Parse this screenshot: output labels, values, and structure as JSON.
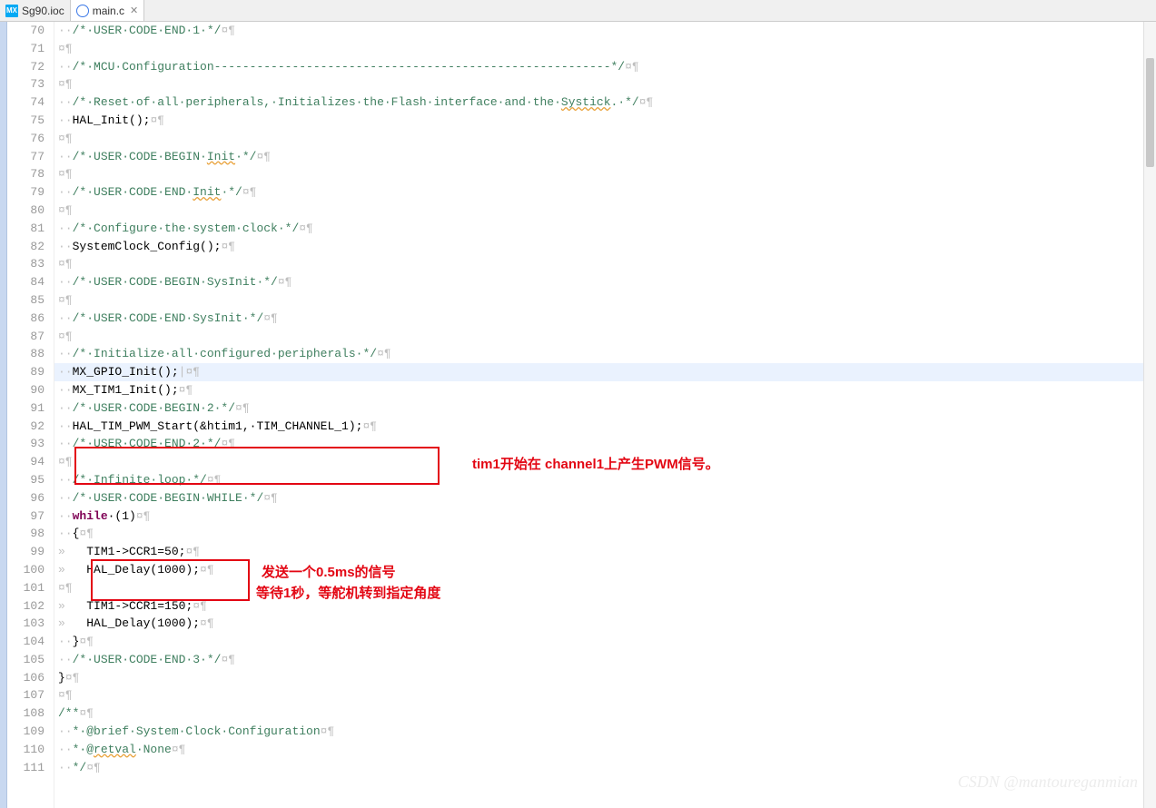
{
  "tabs": [
    {
      "label": "Sg90.ioc",
      "icon": "mx",
      "active": false
    },
    {
      "label": "main.c",
      "icon": "c",
      "active": true
    }
  ],
  "annotations": {
    "a1": "tim1开始在 channel1上产生PWM信号。",
    "a2": "发送一个0.5ms的信号",
    "a3": "等待1秒，等舵机转到指定角度"
  },
  "watermark": "CSDN @mantoureganmian",
  "editor": {
    "first_line": 70,
    "highlighted_line": 89,
    "code": [
      {
        "n": 70,
        "ws": "··",
        "seg": [
          {
            "t": "comment",
            "v": "/*·USER·CODE·END·1·*/"
          },
          {
            "t": "ws",
            "v": "¤¶"
          }
        ]
      },
      {
        "n": 71,
        "ws": "",
        "seg": [
          {
            "t": "ws",
            "v": "¤¶"
          }
        ]
      },
      {
        "n": 72,
        "ws": "··",
        "seg": [
          {
            "t": "comment",
            "v": "/*·MCU·Configuration--------------------------------------------------------*/"
          },
          {
            "t": "ws",
            "v": "¤¶"
          }
        ]
      },
      {
        "n": 73,
        "ws": "",
        "seg": [
          {
            "t": "ws",
            "v": "¤¶"
          }
        ]
      },
      {
        "n": 74,
        "ws": "··",
        "seg": [
          {
            "t": "comment",
            "v": "/*·Reset·of·all·peripherals,·Initializes·the·Flash·interface·and·the·"
          },
          {
            "t": "comment",
            "wavy": true,
            "v": "Systick"
          },
          {
            "t": "comment",
            "v": ".·*/"
          },
          {
            "t": "ws",
            "v": "¤¶"
          }
        ]
      },
      {
        "n": 75,
        "ws": "··",
        "seg": [
          {
            "t": "func",
            "v": "HAL_Init();"
          },
          {
            "t": "ws",
            "v": "¤¶"
          }
        ]
      },
      {
        "n": 76,
        "ws": "",
        "seg": [
          {
            "t": "ws",
            "v": "¤¶"
          }
        ]
      },
      {
        "n": 77,
        "ws": "··",
        "seg": [
          {
            "t": "comment",
            "v": "/*·USER·CODE·BEGIN·"
          },
          {
            "t": "comment",
            "wavy": true,
            "v": "Init"
          },
          {
            "t": "comment",
            "v": "·*/"
          },
          {
            "t": "ws",
            "v": "¤¶"
          }
        ]
      },
      {
        "n": 78,
        "ws": "",
        "seg": [
          {
            "t": "ws",
            "v": "¤¶"
          }
        ]
      },
      {
        "n": 79,
        "ws": "··",
        "seg": [
          {
            "t": "comment",
            "v": "/*·USER·CODE·END·"
          },
          {
            "t": "comment",
            "wavy": true,
            "v": "Init"
          },
          {
            "t": "comment",
            "v": "·*/"
          },
          {
            "t": "ws",
            "v": "¤¶"
          }
        ]
      },
      {
        "n": 80,
        "ws": "",
        "seg": [
          {
            "t": "ws",
            "v": "¤¶"
          }
        ]
      },
      {
        "n": 81,
        "ws": "··",
        "seg": [
          {
            "t": "comment",
            "v": "/*·Configure·the·system·clock·*/"
          },
          {
            "t": "ws",
            "v": "¤¶"
          }
        ]
      },
      {
        "n": 82,
        "ws": "··",
        "seg": [
          {
            "t": "func",
            "v": "SystemClock_Config();"
          },
          {
            "t": "ws",
            "v": "¤¶"
          }
        ]
      },
      {
        "n": 83,
        "ws": "",
        "seg": [
          {
            "t": "ws",
            "v": "¤¶"
          }
        ]
      },
      {
        "n": 84,
        "ws": "··",
        "seg": [
          {
            "t": "comment",
            "v": "/*·USER·CODE·BEGIN·SysInit·*/"
          },
          {
            "t": "ws",
            "v": "¤¶"
          }
        ]
      },
      {
        "n": 85,
        "ws": "",
        "seg": [
          {
            "t": "ws",
            "v": "¤¶"
          }
        ]
      },
      {
        "n": 86,
        "ws": "··",
        "seg": [
          {
            "t": "comment",
            "v": "/*·USER·CODE·END·SysInit·*/"
          },
          {
            "t": "ws",
            "v": "¤¶"
          }
        ]
      },
      {
        "n": 87,
        "ws": "",
        "seg": [
          {
            "t": "ws",
            "v": "¤¶"
          }
        ]
      },
      {
        "n": 88,
        "ws": "··",
        "seg": [
          {
            "t": "comment",
            "v": "/*·Initialize·all·configured·peripherals·*/"
          },
          {
            "t": "ws",
            "v": "¤¶"
          }
        ]
      },
      {
        "n": 89,
        "ws": "··",
        "seg": [
          {
            "t": "func",
            "v": "MX_GPIO_Init();"
          },
          {
            "t": "ws",
            "v": "|¤¶"
          }
        ]
      },
      {
        "n": 90,
        "ws": "··",
        "seg": [
          {
            "t": "func",
            "v": "MX_TIM1_Init();"
          },
          {
            "t": "ws",
            "v": "¤¶"
          }
        ]
      },
      {
        "n": 91,
        "ws": "··",
        "seg": [
          {
            "t": "comment",
            "v": "/*·USER·CODE·BEGIN·2·*/"
          },
          {
            "t": "ws",
            "v": "¤¶"
          }
        ]
      },
      {
        "n": 92,
        "ws": "··",
        "seg": [
          {
            "t": "func",
            "v": "HAL_TIM_PWM_Start(&htim1,·TIM_CHANNEL_1);"
          },
          {
            "t": "ws",
            "v": "¤¶"
          }
        ]
      },
      {
        "n": 93,
        "ws": "··",
        "seg": [
          {
            "t": "comment",
            "v": "/*·USER·CODE·END·2·*/"
          },
          {
            "t": "ws",
            "v": "¤¶"
          }
        ]
      },
      {
        "n": 94,
        "ws": "",
        "seg": [
          {
            "t": "ws",
            "v": "¤¶"
          }
        ]
      },
      {
        "n": 95,
        "ws": "··",
        "seg": [
          {
            "t": "comment",
            "v": "/*·Infinite·loop·*/"
          },
          {
            "t": "ws",
            "v": "¤¶"
          }
        ]
      },
      {
        "n": 96,
        "ws": "··",
        "seg": [
          {
            "t": "comment",
            "v": "/*·USER·CODE·BEGIN·WHILE·*/"
          },
          {
            "t": "ws",
            "v": "¤¶"
          }
        ]
      },
      {
        "n": 97,
        "ws": "··",
        "seg": [
          {
            "t": "kw",
            "v": "while"
          },
          {
            "t": "func",
            "v": "·(1)"
          },
          {
            "t": "ws",
            "v": "¤¶"
          }
        ]
      },
      {
        "n": 98,
        "ws": "··",
        "seg": [
          {
            "t": "func",
            "v": "{"
          },
          {
            "t": "ws",
            "v": "¤¶"
          }
        ]
      },
      {
        "n": 99,
        "ws": "»   ",
        "seg": [
          {
            "t": "func",
            "v": "TIM1->"
          },
          {
            "t": "func",
            "v": "CCR1"
          },
          {
            "t": "func",
            "v": "=50;"
          },
          {
            "t": "ws",
            "v": "¤¶"
          }
        ]
      },
      {
        "n": 100,
        "ws": "»   ",
        "seg": [
          {
            "t": "func",
            "v": "HAL_Delay(1000);"
          },
          {
            "t": "ws",
            "v": "¤¶"
          }
        ]
      },
      {
        "n": 101,
        "ws": "",
        "seg": [
          {
            "t": "ws",
            "v": "¤¶"
          }
        ]
      },
      {
        "n": 102,
        "ws": "»   ",
        "seg": [
          {
            "t": "func",
            "v": "TIM1->"
          },
          {
            "t": "func",
            "v": "CCR1"
          },
          {
            "t": "func",
            "v": "=150;"
          },
          {
            "t": "ws",
            "v": "¤¶"
          }
        ]
      },
      {
        "n": 103,
        "ws": "»   ",
        "seg": [
          {
            "t": "func",
            "v": "HAL_Delay(1000);"
          },
          {
            "t": "ws",
            "v": "¤¶"
          }
        ]
      },
      {
        "n": 104,
        "ws": "··",
        "seg": [
          {
            "t": "func",
            "v": "}"
          },
          {
            "t": "ws",
            "v": "¤¶"
          }
        ]
      },
      {
        "n": 105,
        "ws": "··",
        "seg": [
          {
            "t": "comment",
            "v": "/*·USER·CODE·END·3·*/"
          },
          {
            "t": "ws",
            "v": "¤¶"
          }
        ]
      },
      {
        "n": 106,
        "ws": "",
        "seg": [
          {
            "t": "func",
            "v": "}"
          },
          {
            "t": "ws",
            "v": "¤¶"
          }
        ]
      },
      {
        "n": 107,
        "ws": "",
        "seg": [
          {
            "t": "ws",
            "v": "¤¶"
          }
        ]
      },
      {
        "n": 108,
        "ws": "",
        "seg": [
          {
            "t": "comment",
            "v": "/**"
          },
          {
            "t": "ws",
            "v": "¤¶"
          }
        ]
      },
      {
        "n": 109,
        "ws": "··",
        "seg": [
          {
            "t": "comment",
            "v": "*·@brief·System·Clock·Configuration"
          },
          {
            "t": "ws",
            "v": "¤¶"
          }
        ]
      },
      {
        "n": 110,
        "ws": "··",
        "seg": [
          {
            "t": "comment",
            "v": "*·@"
          },
          {
            "t": "comment",
            "wavy": true,
            "v": "retval"
          },
          {
            "t": "comment",
            "v": "·None"
          },
          {
            "t": "ws",
            "v": "¤¶"
          }
        ]
      },
      {
        "n": 111,
        "ws": "··",
        "seg": [
          {
            "t": "comment",
            "v": "*/"
          },
          {
            "t": "ws",
            "v": "¤¶"
          }
        ]
      }
    ]
  }
}
